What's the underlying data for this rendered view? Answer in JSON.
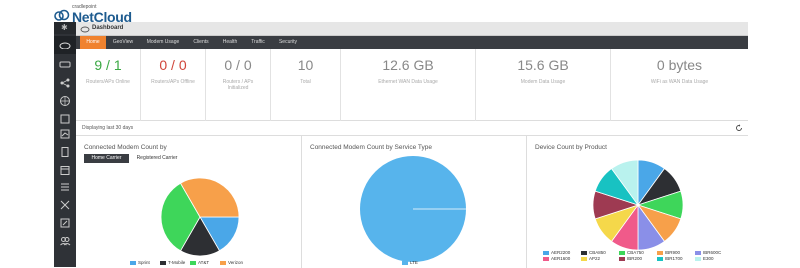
{
  "brand": {
    "small": "cradlepoint",
    "name": "NetCloud"
  },
  "titlebar": {
    "title": "Dashboard"
  },
  "tabs": [
    {
      "label": "Home",
      "active": true
    },
    {
      "label": "GeoView"
    },
    {
      "label": "Modem Usage"
    },
    {
      "label": "Clients"
    },
    {
      "label": "Health"
    },
    {
      "label": "Traffic"
    },
    {
      "label": "Security"
    }
  ],
  "stats": [
    {
      "value": "9 / 1",
      "label": "Routers/APs Online",
      "color": "#3aa843"
    },
    {
      "value": "0 / 0",
      "label": "Routers/APs Offline",
      "color": "#d0453a"
    },
    {
      "value": "0 / 0",
      "label": "Routers / APs Initialized",
      "color": "#888888"
    },
    {
      "value": "10",
      "label": "Total",
      "color": "#888888"
    },
    {
      "value": "12.6 GB",
      "label": "Ethernet WAN Data Usage",
      "color": "#888888"
    },
    {
      "value": "15.6 GB",
      "label": "Modem Data Usage",
      "color": "#888888"
    },
    {
      "value": "0 bytes",
      "label": "WiFi as WAN Data Usage",
      "color": "#888888"
    }
  ],
  "range_text": "Displaying last 30 days",
  "panels": {
    "carrier": {
      "title": "Connected Modem Count by",
      "buttons": [
        {
          "label": "Home Carrier",
          "active": true
        },
        {
          "label": "Registered Carrier"
        }
      ]
    },
    "service": {
      "title": "Connected Modem Count by Service Type"
    },
    "product": {
      "title": "Device Count by Product"
    }
  },
  "chart_data": [
    {
      "type": "pie",
      "title": "Connected Modem Count by",
      "categories": [
        "Sprint",
        "T-Mobile",
        "AT&T",
        "Verizon"
      ],
      "values": [
        2,
        2,
        4,
        4
      ],
      "colors": [
        "#4aa7e8",
        "#2d2f33",
        "#3ed65a",
        "#f7a04a"
      ]
    },
    {
      "type": "pie",
      "title": "Connected Modem Count by Service Type",
      "categories": [
        "LTE"
      ],
      "values": [
        1
      ],
      "colors": [
        "#57b4ec"
      ]
    },
    {
      "type": "pie",
      "title": "Device Count by Product",
      "categories": [
        "AER2200",
        "CBA850",
        "CBA750",
        "IBR900",
        "IBR600C",
        "AER1600",
        "AP22",
        "IBR200",
        "IBR1700",
        "E300"
      ],
      "values": [
        1,
        1,
        1,
        1,
        1,
        1,
        1,
        1,
        1,
        1
      ],
      "colors": [
        "#4aa7e8",
        "#2d2f33",
        "#3ed65a",
        "#f7a04a",
        "#8a8fe8",
        "#f05a8a",
        "#f5d84a",
        "#9e3a52",
        "#18c2c2",
        "#b9f2ee"
      ]
    }
  ]
}
